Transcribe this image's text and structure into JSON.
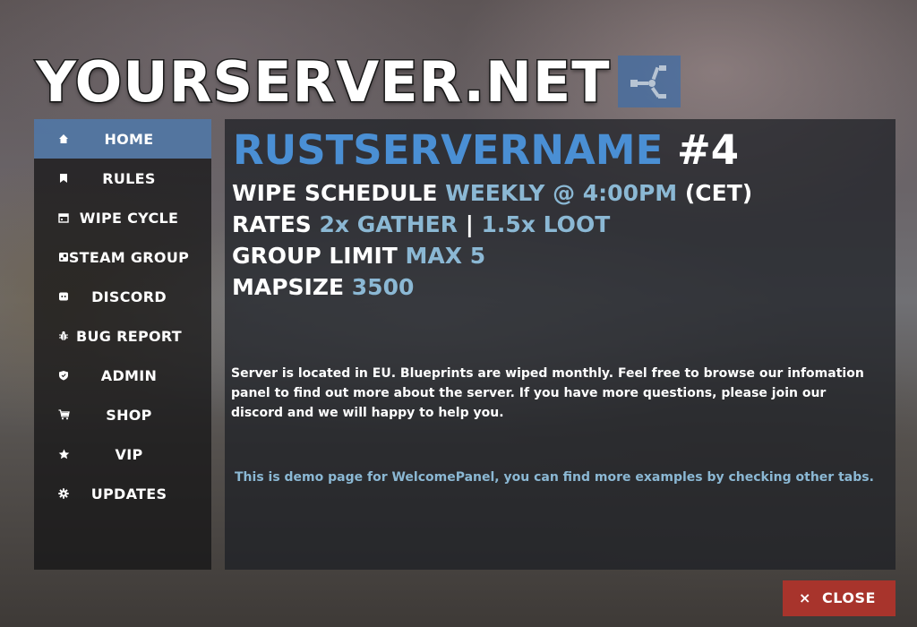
{
  "logo": {
    "text": "YOURSERVER.NET",
    "badge_icon": "rust-logo-icon"
  },
  "sidebar": {
    "items": [
      {
        "label": "HOME",
        "icon": "home-icon",
        "active": true
      },
      {
        "label": "RULES",
        "icon": "bookmark-icon",
        "active": false
      },
      {
        "label": "WIPE CYCLE",
        "icon": "calendar-icon",
        "active": false
      },
      {
        "label": "STEAM GROUP",
        "icon": "steam-icon",
        "active": false
      },
      {
        "label": "DISCORD",
        "icon": "discord-icon",
        "active": false
      },
      {
        "label": "BUG REPORT",
        "icon": "bug-icon",
        "active": false
      },
      {
        "label": "ADMIN",
        "icon": "shield-icon",
        "active": false
      },
      {
        "label": "SHOP",
        "icon": "cart-icon",
        "active": false
      },
      {
        "label": "VIP",
        "icon": "star-icon",
        "active": false
      },
      {
        "label": "UPDATES",
        "icon": "gear-icon",
        "active": false
      }
    ]
  },
  "main": {
    "server_name": "RUSTSERVERNAME",
    "server_number": "#4",
    "info": [
      {
        "key": "WIPE SCHEDULE",
        "value_parts": [
          "WEEKLY @ 4:00PM",
          " (CET)"
        ]
      },
      {
        "key": "RATES",
        "value_parts": [
          "2x GATHER",
          " | ",
          "1.5x LOOT"
        ]
      },
      {
        "key": "GROUP LIMIT",
        "value_parts": [
          "MAX 5"
        ]
      },
      {
        "key": "MAPSIZE",
        "value_parts": [
          "3500"
        ]
      }
    ],
    "description": "Server is located in EU. Blueprints are wiped monthly. Feel free to browse our infomation panel to find out more about the server. If you have more questions, please join our discord and we will happy to help you.",
    "note": "This is demo page for WelcomePanel, you can find more examples by checking other tabs."
  },
  "close_button": {
    "icon_text": "×",
    "label": "CLOSE"
  },
  "colors": {
    "accent_blue": "#4a8fd4",
    "value_blue": "#8bb8d4",
    "active_nav": "#5a82b4",
    "close_red": "#a8342c"
  }
}
